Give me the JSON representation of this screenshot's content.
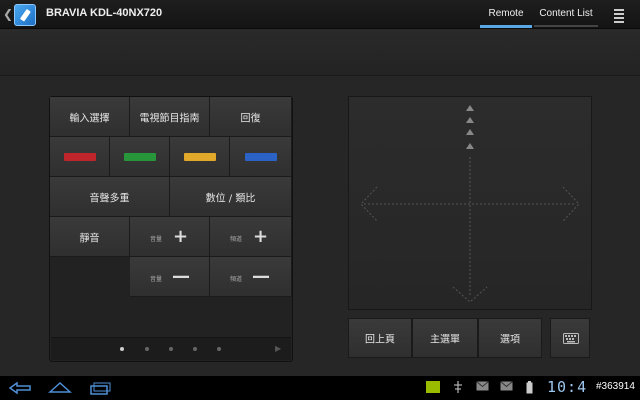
{
  "header": {
    "title": "BRAVIA KDL-40NX720",
    "tabs": [
      {
        "label": "Remote",
        "active": true
      },
      {
        "label": "Content List",
        "active": false
      }
    ]
  },
  "remote": {
    "row1": [
      "輸入選擇",
      "電視節目指南",
      "回復"
    ],
    "colors": [
      "#c0252b",
      "#27953a",
      "#e2a82a",
      "#2b62c6"
    ],
    "row3": [
      "音聲多重",
      "數位 / 類比"
    ],
    "mute": "靜音",
    "volume_label": "音量",
    "channel_label": "頻道",
    "plus": "+",
    "minus": "—",
    "pager_dots": 5,
    "active_dot": 0
  },
  "bottom": {
    "buttons": [
      "回上頁",
      "主選單",
      "選項"
    ]
  },
  "statusbar": {
    "clock": "10:4",
    "watermark": "#363914"
  }
}
